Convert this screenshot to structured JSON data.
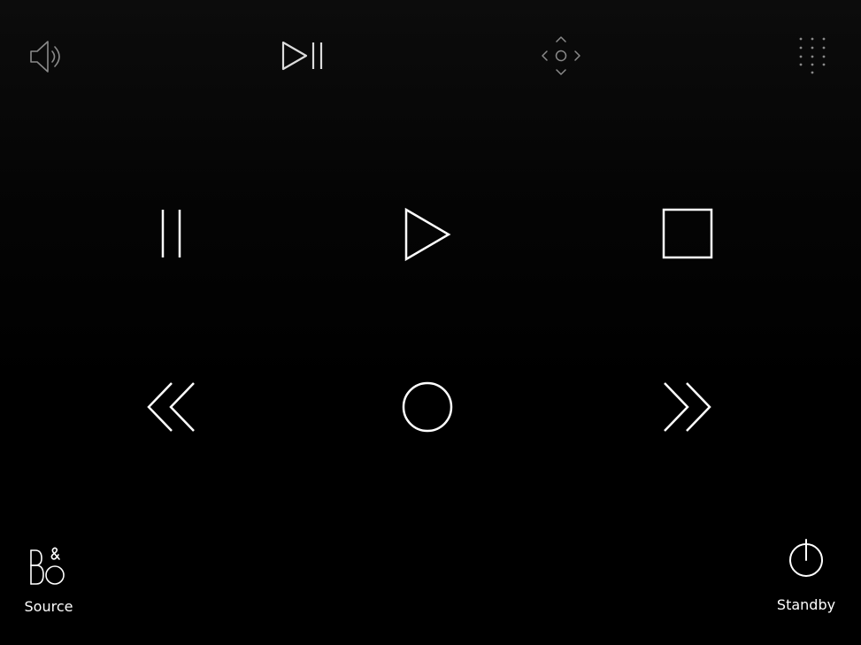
{
  "top_bar": {
    "items": [
      {
        "name": "volume",
        "icon": "speaker-volume-icon"
      },
      {
        "name": "play-pause",
        "icon": "play-pause-icon"
      },
      {
        "name": "navigation",
        "icon": "dpad-navigation-icon"
      },
      {
        "name": "keypad",
        "icon": "numeric-keypad-icon"
      }
    ]
  },
  "transport": {
    "items": [
      {
        "name": "pause",
        "icon": "pause-icon"
      },
      {
        "name": "play",
        "icon": "play-icon"
      },
      {
        "name": "stop",
        "icon": "stop-icon"
      },
      {
        "name": "rewind",
        "icon": "rewind-icon"
      },
      {
        "name": "record",
        "icon": "record-circle-icon"
      },
      {
        "name": "fast-forward",
        "icon": "fast-forward-icon"
      }
    ]
  },
  "bottom_bar": {
    "source": {
      "label": "Source",
      "icon": "bang-olufsen-logo-icon"
    },
    "standby": {
      "label": "Standby",
      "icon": "power-icon"
    }
  },
  "colors": {
    "background": "#000000",
    "top_icons": "#8a8a8a",
    "main_icons": "#ffffff"
  }
}
